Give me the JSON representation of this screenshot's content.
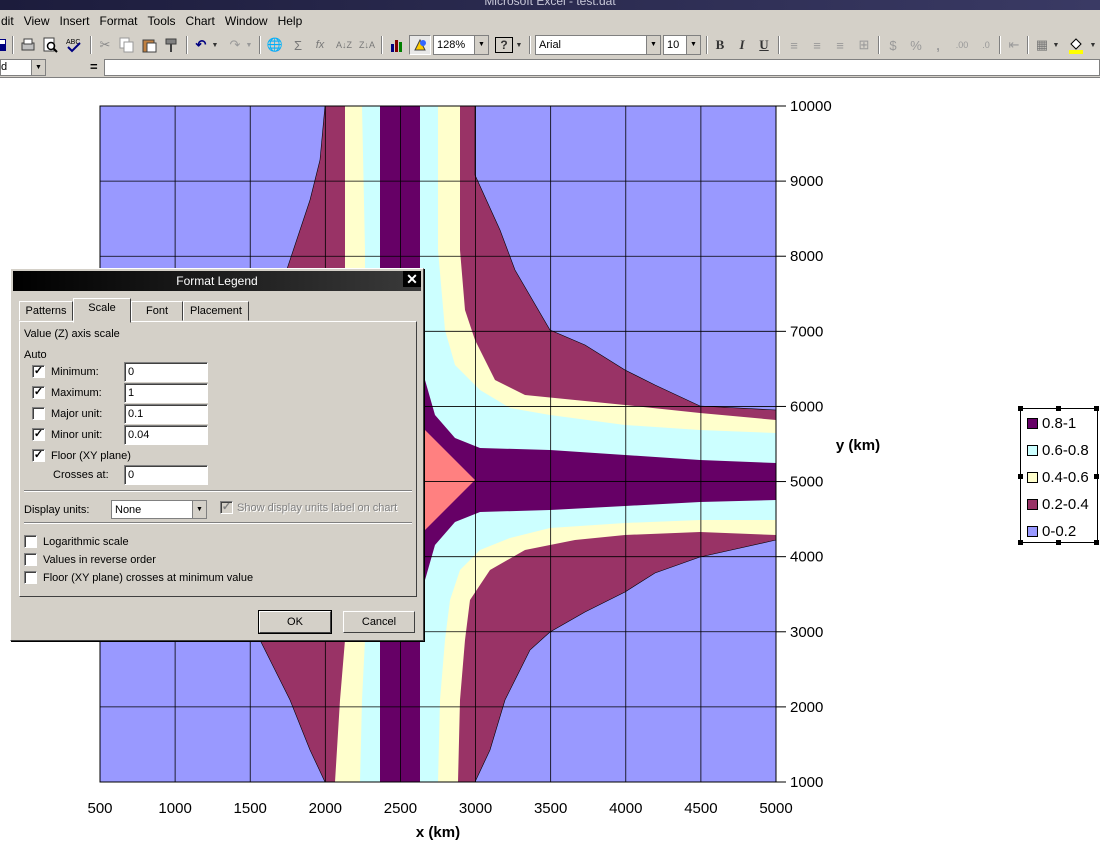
{
  "window": {
    "title": "Microsoft Excel - test.dat"
  },
  "menu": [
    "dit",
    "View",
    "Insert",
    "Format",
    "Tools",
    "Chart",
    "Window",
    "Help"
  ],
  "toolbar": {
    "zoom": "128%",
    "font_name": "Arial",
    "font_size": "10",
    "bold": "B",
    "italic": "I",
    "underline": "U",
    "sum": "Σ",
    "fx": "fx",
    "currency": "$",
    "percent": "%",
    "comma": ","
  },
  "formula_bar": {
    "name_box": "d",
    "equals": "=",
    "content": ""
  },
  "chart_data": {
    "type": "contour",
    "xlabel": "x (km)",
    "ylabel": "y (km)",
    "xlim": [
      500,
      5000
    ],
    "ylim": [
      1000,
      10000
    ],
    "x_ticks": [
      "500",
      "1000",
      "1500",
      "2000",
      "2500",
      "3000",
      "3500",
      "4000",
      "4500",
      "5000"
    ],
    "y_ticks": [
      "10000",
      "9000",
      "8000",
      "7000",
      "6000",
      "5000",
      "4000",
      "3000",
      "2000",
      "1000"
    ],
    "grid": true,
    "legend_position": "right",
    "bands": [
      {
        "name": "0.8-1",
        "color": "#660066"
      },
      {
        "name": "0.6-0.8",
        "color": "#ccffff"
      },
      {
        "name": "0.4-0.6",
        "color": "#ffffcc"
      },
      {
        "name": "0.2-0.4",
        "color": "#993366"
      },
      {
        "name": "0-0.2",
        "color": "#9999ff"
      }
    ]
  },
  "dialog": {
    "title": "Format Legend",
    "tabs": [
      "Patterns",
      "Scale",
      "Font",
      "Placement"
    ],
    "active_tab": "Scale",
    "section_title": "Value (Z) axis scale",
    "auto_label": "Auto",
    "minimum": {
      "label": "Minimum:",
      "checked": true,
      "value": "0"
    },
    "maximum": {
      "label": "Maximum:",
      "checked": true,
      "value": "1"
    },
    "major_unit": {
      "label": "Major unit:",
      "checked": false,
      "value": "0.1"
    },
    "minor_unit": {
      "label": "Minor unit:",
      "checked": true,
      "value": "0.04"
    },
    "floor": {
      "label": "Floor (XY plane)",
      "checked": true
    },
    "crosses_at": {
      "label": "Crosses at:",
      "value": "0"
    },
    "display_units": {
      "label": "Display units:",
      "value": "None"
    },
    "show_units_label": {
      "label": "Show display units label on chart",
      "checked": true,
      "enabled": false
    },
    "logarithmic": {
      "label": "Logarithmic scale",
      "checked": false
    },
    "reverse": {
      "label": "Values in reverse order",
      "checked": false
    },
    "floor_min": {
      "label": "Floor (XY plane) crosses at minimum value",
      "checked": false
    },
    "ok": "OK",
    "cancel": "Cancel"
  }
}
